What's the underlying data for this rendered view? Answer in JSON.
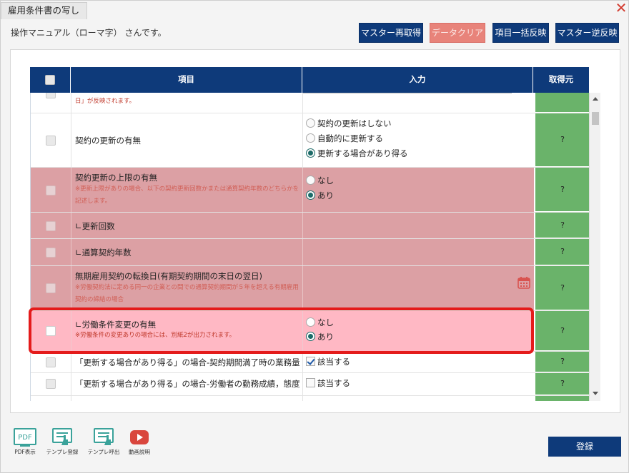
{
  "window": {
    "title": "雇用条件書の写し",
    "user_message": "操作マニュアル（ローマ字） さんです。"
  },
  "toolbar": {
    "master_refetch": "マスター再取得",
    "data_clear": "データクリア",
    "bulk_apply": "項目一括反映",
    "master_reverse": "マスター逆反映"
  },
  "table": {
    "headers": {
      "item": "項目",
      "input": "入力",
      "source": "取得元"
    },
    "rows": [
      {
        "item": "",
        "note": "日」が反映されます。",
        "source": ""
      },
      {
        "item": "契約の更新の有無",
        "options": [
          "契約の更新はしない",
          "自動的に更新する",
          "更新する場合があり得る"
        ],
        "selected": 2,
        "source": "?"
      },
      {
        "item": "契約更新の上限の有無",
        "note": "※更新上限がありの場合、以下の契約更新回数かまたは通算契約年数のどちらかを記述します。",
        "options": [
          "なし",
          "あり"
        ],
        "selected": 1,
        "source": "?"
      },
      {
        "item": "∟更新回数",
        "source": "?"
      },
      {
        "item": "∟通算契約年数",
        "source": "?"
      },
      {
        "item": "無期雇用契約の転換日(有期契約期間の末日の翌日)",
        "note": "※労働契約法に定める同一の企業との間での通算契約期間が５年を超える有期雇用契約の締結の場合",
        "source": "?"
      },
      {
        "item": "∟労働条件変更の有無",
        "note": "※労働条件の変更ありの場合には、別紙2が出力されます。",
        "options": [
          "なし",
          "あり"
        ],
        "selected": 1,
        "source": "?"
      },
      {
        "item": "「更新する場合があり得る」の場合-契約期間満了時の業務量",
        "check_label": "該当する",
        "checked": true,
        "source": "?"
      },
      {
        "item": "「更新する場合があり得る」の場合-労働者の勤務成績，態度",
        "check_label": "該当する",
        "checked": false,
        "source": "?"
      }
    ]
  },
  "tools": {
    "pdf": "PDF表示",
    "template_register": "テンプレ登録",
    "template_load": "テンプレ呼出",
    "video": "動画説明"
  },
  "register": "登録"
}
